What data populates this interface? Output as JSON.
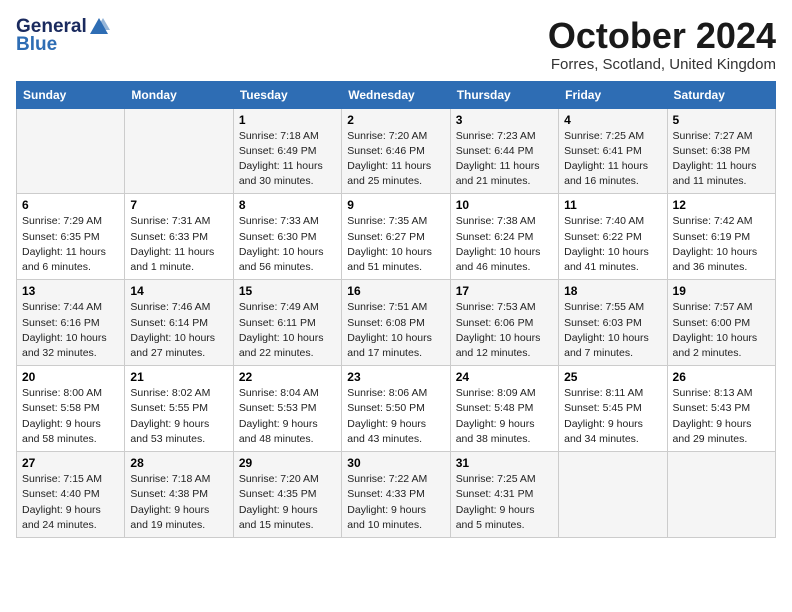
{
  "logo": {
    "general": "General",
    "blue": "Blue"
  },
  "title": "October 2024",
  "location": "Forres, Scotland, United Kingdom",
  "days_of_week": [
    "Sunday",
    "Monday",
    "Tuesday",
    "Wednesday",
    "Thursday",
    "Friday",
    "Saturday"
  ],
  "weeks": [
    [
      {
        "day": "",
        "sunrise": "",
        "sunset": "",
        "daylight": ""
      },
      {
        "day": "",
        "sunrise": "",
        "sunset": "",
        "daylight": ""
      },
      {
        "day": "1",
        "sunrise": "Sunrise: 7:18 AM",
        "sunset": "Sunset: 6:49 PM",
        "daylight": "Daylight: 11 hours and 30 minutes."
      },
      {
        "day": "2",
        "sunrise": "Sunrise: 7:20 AM",
        "sunset": "Sunset: 6:46 PM",
        "daylight": "Daylight: 11 hours and 25 minutes."
      },
      {
        "day": "3",
        "sunrise": "Sunrise: 7:23 AM",
        "sunset": "Sunset: 6:44 PM",
        "daylight": "Daylight: 11 hours and 21 minutes."
      },
      {
        "day": "4",
        "sunrise": "Sunrise: 7:25 AM",
        "sunset": "Sunset: 6:41 PM",
        "daylight": "Daylight: 11 hours and 16 minutes."
      },
      {
        "day": "5",
        "sunrise": "Sunrise: 7:27 AM",
        "sunset": "Sunset: 6:38 PM",
        "daylight": "Daylight: 11 hours and 11 minutes."
      }
    ],
    [
      {
        "day": "6",
        "sunrise": "Sunrise: 7:29 AM",
        "sunset": "Sunset: 6:35 PM",
        "daylight": "Daylight: 11 hours and 6 minutes."
      },
      {
        "day": "7",
        "sunrise": "Sunrise: 7:31 AM",
        "sunset": "Sunset: 6:33 PM",
        "daylight": "Daylight: 11 hours and 1 minute."
      },
      {
        "day": "8",
        "sunrise": "Sunrise: 7:33 AM",
        "sunset": "Sunset: 6:30 PM",
        "daylight": "Daylight: 10 hours and 56 minutes."
      },
      {
        "day": "9",
        "sunrise": "Sunrise: 7:35 AM",
        "sunset": "Sunset: 6:27 PM",
        "daylight": "Daylight: 10 hours and 51 minutes."
      },
      {
        "day": "10",
        "sunrise": "Sunrise: 7:38 AM",
        "sunset": "Sunset: 6:24 PM",
        "daylight": "Daylight: 10 hours and 46 minutes."
      },
      {
        "day": "11",
        "sunrise": "Sunrise: 7:40 AM",
        "sunset": "Sunset: 6:22 PM",
        "daylight": "Daylight: 10 hours and 41 minutes."
      },
      {
        "day": "12",
        "sunrise": "Sunrise: 7:42 AM",
        "sunset": "Sunset: 6:19 PM",
        "daylight": "Daylight: 10 hours and 36 minutes."
      }
    ],
    [
      {
        "day": "13",
        "sunrise": "Sunrise: 7:44 AM",
        "sunset": "Sunset: 6:16 PM",
        "daylight": "Daylight: 10 hours and 32 minutes."
      },
      {
        "day": "14",
        "sunrise": "Sunrise: 7:46 AM",
        "sunset": "Sunset: 6:14 PM",
        "daylight": "Daylight: 10 hours and 27 minutes."
      },
      {
        "day": "15",
        "sunrise": "Sunrise: 7:49 AM",
        "sunset": "Sunset: 6:11 PM",
        "daylight": "Daylight: 10 hours and 22 minutes."
      },
      {
        "day": "16",
        "sunrise": "Sunrise: 7:51 AM",
        "sunset": "Sunset: 6:08 PM",
        "daylight": "Daylight: 10 hours and 17 minutes."
      },
      {
        "day": "17",
        "sunrise": "Sunrise: 7:53 AM",
        "sunset": "Sunset: 6:06 PM",
        "daylight": "Daylight: 10 hours and 12 minutes."
      },
      {
        "day": "18",
        "sunrise": "Sunrise: 7:55 AM",
        "sunset": "Sunset: 6:03 PM",
        "daylight": "Daylight: 10 hours and 7 minutes."
      },
      {
        "day": "19",
        "sunrise": "Sunrise: 7:57 AM",
        "sunset": "Sunset: 6:00 PM",
        "daylight": "Daylight: 10 hours and 2 minutes."
      }
    ],
    [
      {
        "day": "20",
        "sunrise": "Sunrise: 8:00 AM",
        "sunset": "Sunset: 5:58 PM",
        "daylight": "Daylight: 9 hours and 58 minutes."
      },
      {
        "day": "21",
        "sunrise": "Sunrise: 8:02 AM",
        "sunset": "Sunset: 5:55 PM",
        "daylight": "Daylight: 9 hours and 53 minutes."
      },
      {
        "day": "22",
        "sunrise": "Sunrise: 8:04 AM",
        "sunset": "Sunset: 5:53 PM",
        "daylight": "Daylight: 9 hours and 48 minutes."
      },
      {
        "day": "23",
        "sunrise": "Sunrise: 8:06 AM",
        "sunset": "Sunset: 5:50 PM",
        "daylight": "Daylight: 9 hours and 43 minutes."
      },
      {
        "day": "24",
        "sunrise": "Sunrise: 8:09 AM",
        "sunset": "Sunset: 5:48 PM",
        "daylight": "Daylight: 9 hours and 38 minutes."
      },
      {
        "day": "25",
        "sunrise": "Sunrise: 8:11 AM",
        "sunset": "Sunset: 5:45 PM",
        "daylight": "Daylight: 9 hours and 34 minutes."
      },
      {
        "day": "26",
        "sunrise": "Sunrise: 8:13 AM",
        "sunset": "Sunset: 5:43 PM",
        "daylight": "Daylight: 9 hours and 29 minutes."
      }
    ],
    [
      {
        "day": "27",
        "sunrise": "Sunrise: 7:15 AM",
        "sunset": "Sunset: 4:40 PM",
        "daylight": "Daylight: 9 hours and 24 minutes."
      },
      {
        "day": "28",
        "sunrise": "Sunrise: 7:18 AM",
        "sunset": "Sunset: 4:38 PM",
        "daylight": "Daylight: 9 hours and 19 minutes."
      },
      {
        "day": "29",
        "sunrise": "Sunrise: 7:20 AM",
        "sunset": "Sunset: 4:35 PM",
        "daylight": "Daylight: 9 hours and 15 minutes."
      },
      {
        "day": "30",
        "sunrise": "Sunrise: 7:22 AM",
        "sunset": "Sunset: 4:33 PM",
        "daylight": "Daylight: 9 hours and 10 minutes."
      },
      {
        "day": "31",
        "sunrise": "Sunrise: 7:25 AM",
        "sunset": "Sunset: 4:31 PM",
        "daylight": "Daylight: 9 hours and 5 minutes."
      },
      {
        "day": "",
        "sunrise": "",
        "sunset": "",
        "daylight": ""
      },
      {
        "day": "",
        "sunrise": "",
        "sunset": "",
        "daylight": ""
      }
    ]
  ]
}
